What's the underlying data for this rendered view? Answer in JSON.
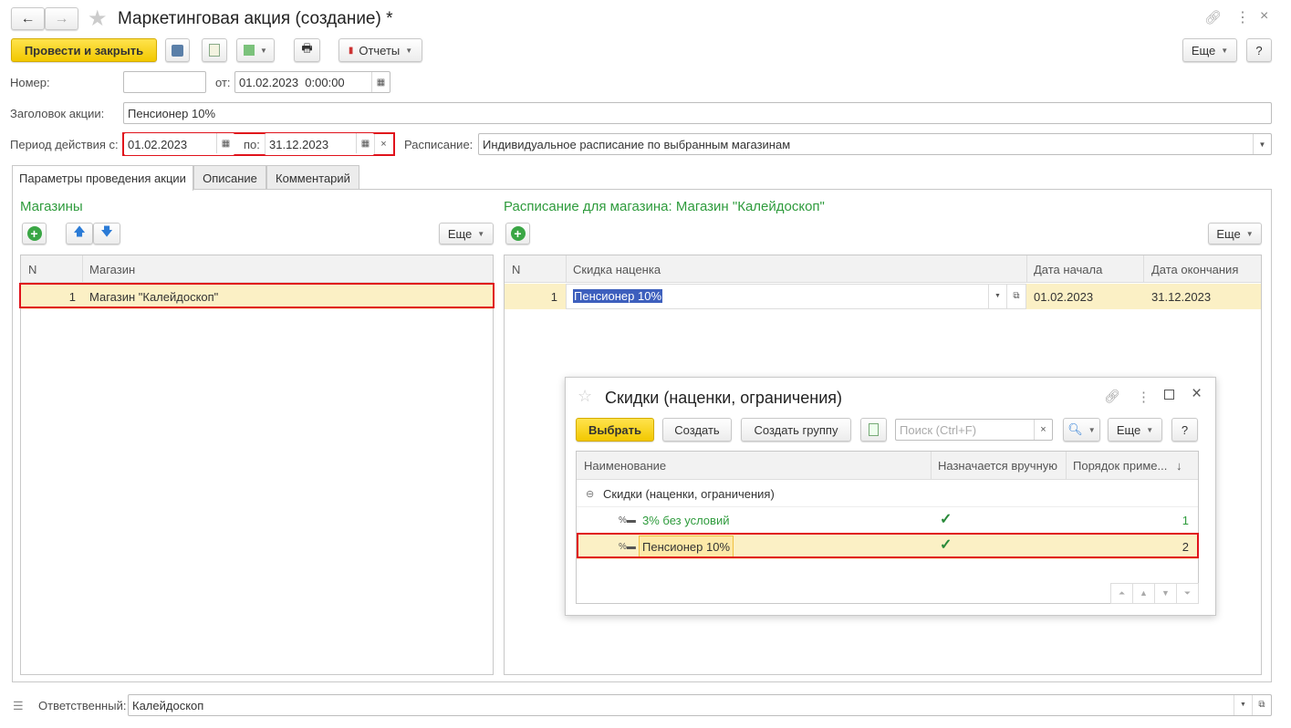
{
  "window": {
    "title": "Маркетинговая акция (создание) *"
  },
  "toolbar": {
    "post_close": "Провести и закрыть",
    "reports": "Отчеты",
    "more": "Еще",
    "help": "?"
  },
  "form": {
    "number_label": "Номер:",
    "number_value": "",
    "from_label": "от:",
    "from_value": "01.02.2023  0:00:00",
    "header_label": "Заголовок акции:",
    "header_value": "Пенсионер 10%",
    "period_label": "Период действия с:",
    "period_from": "01.02.2023",
    "period_to_label": "по:",
    "period_to": "31.12.2023",
    "schedule_label": "Расписание:",
    "schedule_value": "Индивидуальное расписание по выбранным магазинам",
    "clear": "×"
  },
  "tabs": [
    {
      "label": "Параметры проведения акции"
    },
    {
      "label": "Описание"
    },
    {
      "label": "Комментарий"
    }
  ],
  "stores": {
    "title": "Магазины",
    "more": "Еще",
    "columns": [
      "N",
      "Магазин"
    ],
    "rows": [
      {
        "n": "1",
        "name": "Магазин \"Калейдоскоп\""
      }
    ]
  },
  "schedule": {
    "title": "Расписание для магазина: Магазин \"Калейдоскоп\"",
    "more": "Еще",
    "columns": [
      "N",
      "Скидка наценка",
      "Дата начала",
      "Дата окончания"
    ],
    "rows": [
      {
        "n": "1",
        "discount": "Пенсионер 10%",
        "start": "01.02.2023",
        "end": "31.12.2023"
      }
    ]
  },
  "dialog": {
    "title": "Скидки (наценки, ограничения)",
    "select": "Выбрать",
    "create": "Создать",
    "create_group": "Создать группу",
    "search_placeholder": "Поиск (Ctrl+F)",
    "clear": "×",
    "more": "Еще",
    "help": "?",
    "columns": [
      "Наименование",
      "Назначается вручную",
      "Порядок приме...",
      "↓"
    ],
    "group": "Скидки (наценки, ограничения)",
    "rows": [
      {
        "name": "3% без условий",
        "manual": "✓",
        "order": "1"
      },
      {
        "name": "Пенсионер 10%",
        "manual": "✓",
        "order": "2"
      }
    ]
  },
  "footer": {
    "responsible_label": "Ответственный:",
    "responsible_value": "Калейдоскоп"
  },
  "colors": {
    "accent_yellow": "#f5cc00",
    "selected_row": "#fbf0c5",
    "highlight": "#e0121b",
    "heading_green": "#2e9b3c"
  }
}
